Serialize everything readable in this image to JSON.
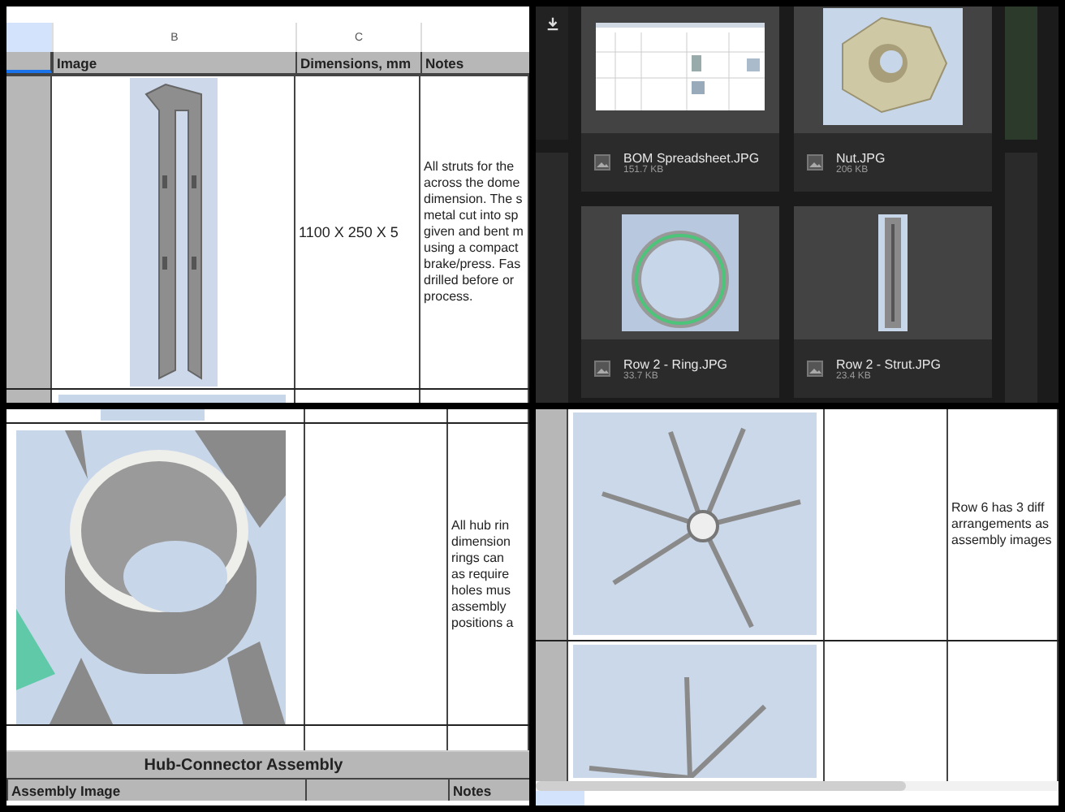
{
  "strut_sheet": {
    "column_headers": [
      "B",
      "C"
    ],
    "header_row": [
      "Image",
      "Dimensions, mm",
      "Notes"
    ],
    "row": {
      "dimensions": "1100 X 250 X 5",
      "notes": "All struts for the\nacross the dome\ndimension. The s\nmetal cut into sp\ngiven and bent m\nusing a compact\nbrake/press. Fas\ndrilled before or\nprocess."
    }
  },
  "gallery": {
    "items": [
      {
        "name": "BOM Spreadsheet.JPG",
        "size": "151.7 KB",
        "kind": "spreadsheet"
      },
      {
        "name": "Nut.JPG",
        "size": "206 KB",
        "kind": "nut"
      },
      {
        "name": "Row 2 - Ring.JPG",
        "size": "33.7 KB",
        "kind": "ring"
      },
      {
        "name": "Row 2 - Strut.JPG",
        "size": "23.4 KB",
        "kind": "strut"
      }
    ]
  },
  "ring_sheet": {
    "notes": "All hub rin\ndimension\nrings can\nas require\nholes mus\nassembly\npositions a",
    "section_title": "Hub-Connector Assembly",
    "header_row": [
      "Assembly Image",
      "Notes"
    ]
  },
  "assembly_sheet": {
    "notes": "Row 6 has 3 diff\narrangements as\nassembly images"
  }
}
